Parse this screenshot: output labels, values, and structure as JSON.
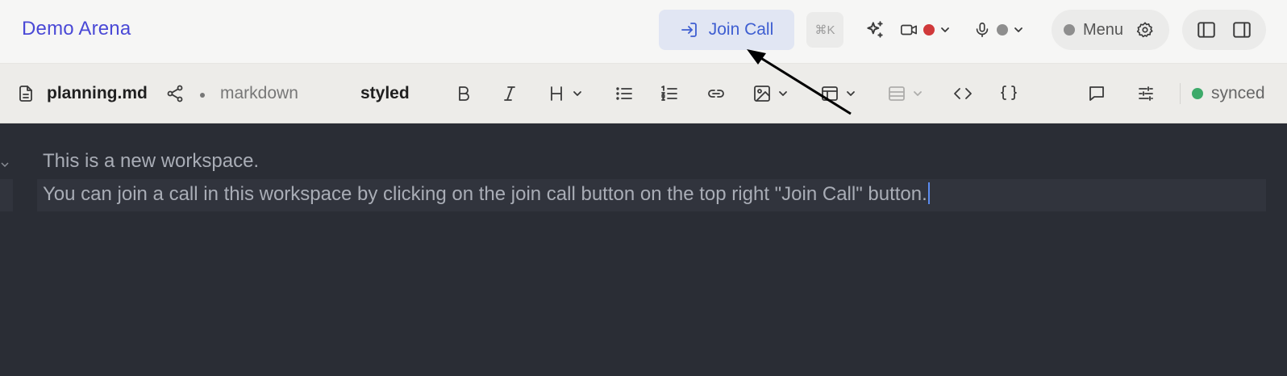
{
  "header": {
    "workspace_title": "Demo Arena",
    "join_call_label": "Join Call",
    "shortcut_label": "⌘K",
    "camera_status_color": "#d0393a",
    "mic_status_color": "#8e8e8e",
    "menu_label": "Menu",
    "menu_status_color": "#8e8e8e"
  },
  "toolbar": {
    "file_name": "planning.md",
    "file_type": "markdown",
    "view_mode": "styled",
    "sync_label": "synced",
    "sync_color": "#3daa6a",
    "icons": [
      "file-icon",
      "share-icon",
      "bold-icon",
      "italic-icon",
      "heading-icon",
      "bullet-list-icon",
      "numbered-list-icon",
      "link-icon",
      "image-icon",
      "table-icon",
      "table-row-icon",
      "code-icon",
      "braces-icon",
      "comment-icon",
      "settings-sliders-icon"
    ]
  },
  "editor": {
    "lines": [
      "This is a new workspace.",
      "You can join a call in this workspace by clicking on the join call button on the top right \"Join Call\" button."
    ]
  },
  "colors": {
    "accent": "#4a49d6",
    "join_button_bg": "#e1e6f3",
    "editor_bg": "#2a2d35"
  }
}
